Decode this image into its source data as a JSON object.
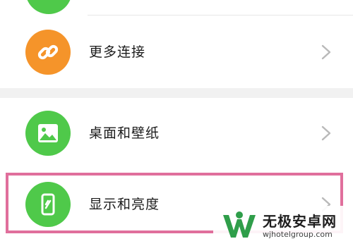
{
  "colors": {
    "top_icon": "#4fc94a",
    "orange": "#f5942a",
    "green": "#4fc94a",
    "highlight": "#e06f9c",
    "chevron": "#b9b9b9",
    "section_gap": "#f1f1f1"
  },
  "settings_rows": [
    {
      "label": "更多连接",
      "icon": "link-icon"
    },
    {
      "label": "桌面和壁纸",
      "icon": "image-icon"
    },
    {
      "label": "显示和亮度",
      "icon": "phone-brightness-icon"
    }
  ],
  "watermark": {
    "title": "无极安卓网",
    "url": "wjhotelgroup.com"
  }
}
